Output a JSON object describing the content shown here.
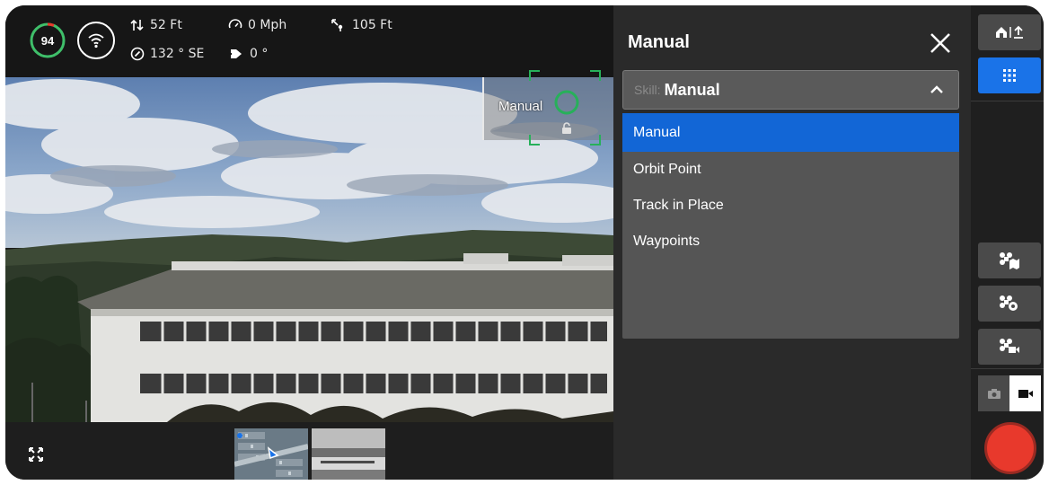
{
  "telemetry": {
    "battery": "94",
    "altitude": "52 Ft",
    "speed": "0 Mph",
    "distance": "105 Ft",
    "heading": "132 ° SE",
    "gimbal": "0 °"
  },
  "camera": {
    "focus_label": "Manual"
  },
  "panel": {
    "title": "Manual",
    "skill_prefix": "Skill:",
    "skill_value": "Manual",
    "options": [
      {
        "label": "Manual",
        "selected": true
      },
      {
        "label": "Orbit Point",
        "selected": false
      },
      {
        "label": "Track in Place",
        "selected": false
      },
      {
        "label": "Waypoints",
        "selected": false
      }
    ]
  },
  "colors": {
    "accent_blue": "#1266d6",
    "battery_green": "#3fbf6a",
    "battery_red": "#e8392c",
    "record_red": "#e8392c",
    "tracking_green": "#27b05a"
  },
  "icons": {
    "home_upload": "home-upload-icon",
    "grid": "grid-icon",
    "drone_map": "drone-map-icon",
    "drone_settings": "drone-settings-icon",
    "drone_camera": "drone-camera-icon",
    "photo": "photo-camera-icon",
    "video": "video-camera-icon"
  }
}
